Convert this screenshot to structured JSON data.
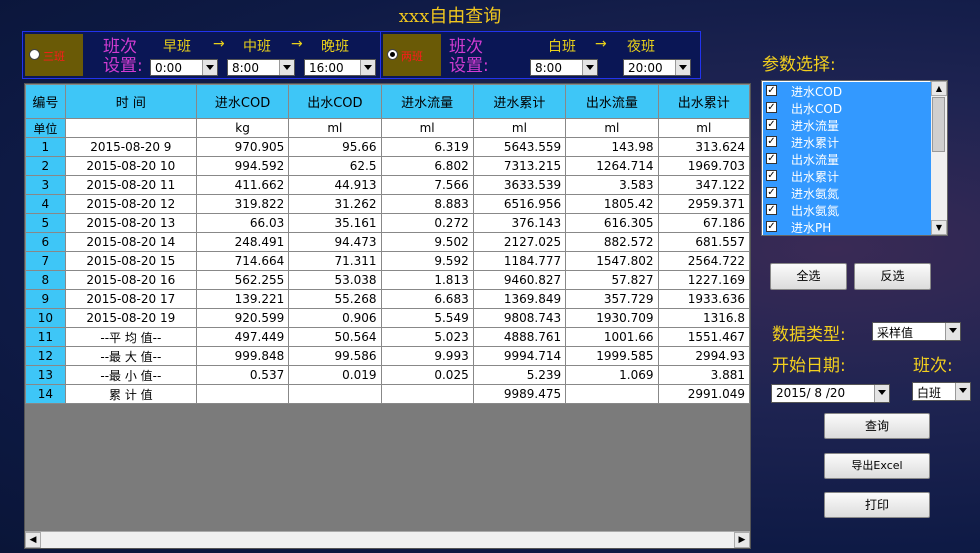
{
  "title": "xxx自由查询",
  "shift3": {
    "radio_label": "三班",
    "label_line1": "班次",
    "label_line2": "设置:",
    "shift_names": [
      "早班",
      "中班",
      "晚班"
    ],
    "arrow": "→",
    "times": [
      "0:00",
      "8:00",
      "16:00"
    ]
  },
  "shift2": {
    "radio_label": "两班",
    "label_line1": "班次",
    "label_line2": "设置:",
    "shift_names": [
      "白班",
      "夜班"
    ],
    "arrow": "→",
    "times": [
      "8:00",
      "20:00"
    ]
  },
  "table": {
    "headers": [
      "编号",
      "时 间",
      "进水COD",
      "出水COD",
      "进水流量",
      "进水累计",
      "出水流量",
      "出水累计"
    ],
    "units_label": "单位",
    "units": [
      "",
      "kg",
      "ml",
      "ml",
      "ml",
      "ml",
      "ml"
    ],
    "rows": [
      {
        "no": "1",
        "cells": [
          "2015-08-20  9",
          "970.905",
          "95.66",
          "6.319",
          "5643.559",
          "143.98",
          "313.624"
        ]
      },
      {
        "no": "2",
        "cells": [
          "2015-08-20  10",
          "994.592",
          "62.5",
          "6.802",
          "7313.215",
          "1264.714",
          "1969.703"
        ]
      },
      {
        "no": "3",
        "cells": [
          "2015-08-20  11",
          "411.662",
          "44.913",
          "7.566",
          "3633.539",
          "3.583",
          "347.122"
        ]
      },
      {
        "no": "4",
        "cells": [
          "2015-08-20  12",
          "319.822",
          "31.262",
          "8.883",
          "6516.956",
          "1805.42",
          "2959.371"
        ]
      },
      {
        "no": "5",
        "cells": [
          "2015-08-20  13",
          "66.03",
          "35.161",
          "0.272",
          "376.143",
          "616.305",
          "67.186"
        ]
      },
      {
        "no": "6",
        "cells": [
          "2015-08-20  14",
          "248.491",
          "94.473",
          "9.502",
          "2127.025",
          "882.572",
          "681.557"
        ]
      },
      {
        "no": "7",
        "cells": [
          "2015-08-20  15",
          "714.664",
          "71.311",
          "9.592",
          "1184.777",
          "1547.802",
          "2564.722"
        ]
      },
      {
        "no": "8",
        "cells": [
          "2015-08-20  16",
          "562.255",
          "53.038",
          "1.813",
          "9460.827",
          "57.827",
          "1227.169"
        ]
      },
      {
        "no": "9",
        "cells": [
          "2015-08-20  17",
          "139.221",
          "55.268",
          "6.683",
          "1369.849",
          "357.729",
          "1933.636"
        ]
      },
      {
        "no": "10",
        "cells": [
          "2015-08-20  19",
          "920.599",
          "0.906",
          "5.549",
          "9808.743",
          "1930.709",
          "1316.8"
        ]
      },
      {
        "no": "11",
        "cells": [
          "--平 均 值--",
          "497.449",
          "50.564",
          "5.023",
          "4888.761",
          "1001.66",
          "1551.467"
        ]
      },
      {
        "no": "12",
        "cells": [
          "--最 大 值--",
          "999.848",
          "99.586",
          "9.993",
          "9994.714",
          "1999.585",
          "2994.93"
        ]
      },
      {
        "no": "13",
        "cells": [
          "--最 小 值--",
          "0.537",
          "0.019",
          "0.025",
          "5.239",
          "1.069",
          "3.881"
        ]
      },
      {
        "no": "14",
        "cells": [
          "累 计 值",
          "",
          "",
          "",
          "9989.475",
          "",
          "2991.049"
        ]
      }
    ]
  },
  "params": {
    "label": "参数选择:",
    "items": [
      "进水COD",
      "出水COD",
      "进水流量",
      "进水累计",
      "出水流量",
      "出水累计",
      "进水氨氮",
      "出水氨氮",
      "进水PH"
    ],
    "check_mark": "✓",
    "select_all": "全选",
    "invert": "反选"
  },
  "query": {
    "data_type_label": "数据类型:",
    "data_type_value": "采样值",
    "start_date_label": "开始日期:",
    "start_date_value": "2015/ 8 /20",
    "shift_label": "班次:",
    "shift_value": "白班"
  },
  "buttons": {
    "query": "查询",
    "export": "导出Excel",
    "print": "打印"
  },
  "scroll": {
    "left": "◀",
    "right": "▶",
    "up": "▲",
    "down": "▼"
  },
  "colors": {
    "header_bg": "#3ec6f7",
    "title": "#f2c81e",
    "selection": "#3399ff"
  }
}
